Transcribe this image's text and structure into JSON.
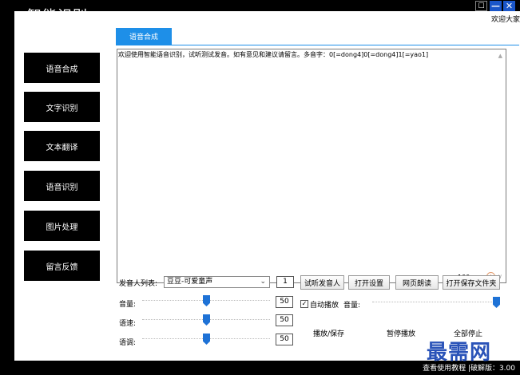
{
  "app": {
    "title": "智能识别"
  },
  "window_buttons": {
    "skin": "☐",
    "minimize": "—",
    "close": "✕"
  },
  "header": {
    "welcome": "欢迎大家"
  },
  "sidebar": {
    "items": [
      {
        "label": "语音合成"
      },
      {
        "label": "文字识别"
      },
      {
        "label": "文本翻译"
      },
      {
        "label": "语音识别"
      },
      {
        "label": "图片处理"
      },
      {
        "label": "留言反馈"
      }
    ]
  },
  "tabs": [
    {
      "label": "语音合成",
      "active": true
    }
  ],
  "editor": {
    "text": "欢迎使用智能语音识别，试听测试发音。如有意见和建议请留言。多音字：0[=dong4]0[=dong4]1[=yao1]",
    "zoom": "100"
  },
  "controls": {
    "voice_label": "发音人列表:",
    "voice_selected": "豆豆-可爱童声",
    "voice_count": "1",
    "volume_label": "音量:",
    "volume_value": "50",
    "volume_level": 0.5,
    "speed_label": "语速:",
    "speed_value": "50",
    "speed_level": 0.5,
    "pitch_label": "语调:",
    "pitch_value": "50",
    "pitch_level": 0.5,
    "audition_button": "试听发音人",
    "settings_button": "打开设置",
    "web_read_button": "网页朗读",
    "open_folder_button": "打开保存文件夹",
    "auto_play_label": "自动播放",
    "auto_play_checked": true,
    "auto_volume_label": "音量:",
    "auto_volume_level": 1.0,
    "play_save_button": "播放/保存",
    "pause_button": "暂停播放",
    "stop_all_button": "全部停止"
  },
  "footer": {
    "text": "查看使用教程 |破解版：3.00"
  },
  "watermark": {
    "text": "最需网"
  },
  "colors": {
    "accent": "#1e8fe8",
    "slider_thumb": "#1e72d6",
    "watermark": "#1f4ab5"
  }
}
